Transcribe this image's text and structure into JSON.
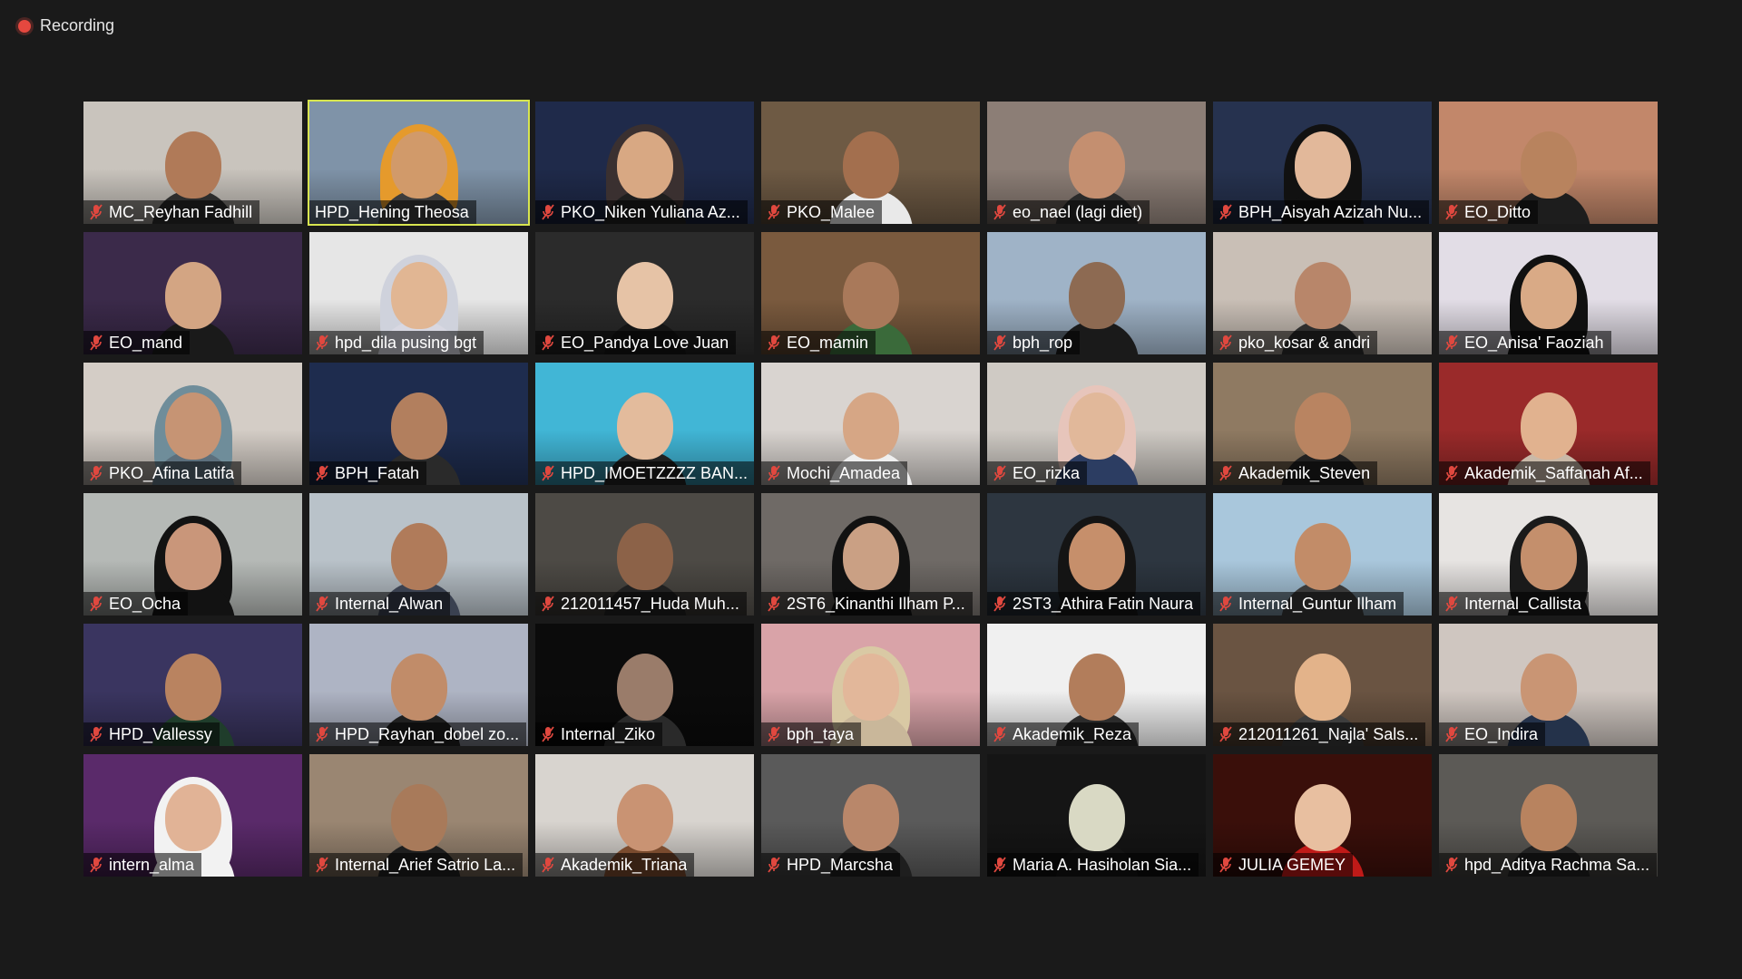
{
  "recording": {
    "label": "Recording",
    "dot_color": "#e5483f"
  },
  "active_speaker_border": "#d8e54f",
  "participants": [
    {
      "name": "MC_Reyhan Fadhill",
      "muted": true,
      "bg": "#c9c4bd",
      "skin": "#b07a58",
      "cloth": "#2c2c2c",
      "active": false
    },
    {
      "name": "HPD_Hening Theosa",
      "muted": false,
      "bg": "#7f93a8",
      "skin": "#d19a6a",
      "cloth": "#3c3c3c",
      "hijab": "#e59a2c",
      "active": true
    },
    {
      "name": "PKO_Niken Yuliana Az...",
      "muted": true,
      "bg": "#1f2a4a",
      "skin": "#d8a883",
      "cloth": "#1e1e1e",
      "hijab": "#3a3030",
      "active": false
    },
    {
      "name": "PKO_Malee",
      "muted": true,
      "bg": "#6e5a44",
      "skin": "#a36f4e",
      "cloth": "#e9e9e9",
      "active": false
    },
    {
      "name": "eo_nael (lagi diet)",
      "muted": true,
      "bg": "#8c7e76",
      "skin": "#c48f70",
      "cloth": "#2a2a2a",
      "active": false
    },
    {
      "name": "BPH_Aisyah Azizah Nu...",
      "muted": true,
      "bg": "#26324f",
      "skin": "#e2b89a",
      "cloth": "#111111",
      "hijab": "#111111",
      "active": false
    },
    {
      "name": "EO_Ditto",
      "muted": true,
      "bg": "#c2876a",
      "skin": "#b8835e",
      "cloth": "#1d1d1d",
      "active": false
    },
    {
      "name": "EO_mand",
      "muted": true,
      "bg": "#3b2a4a",
      "skin": "#d3a583",
      "cloth": "#1a1a1a",
      "active": false
    },
    {
      "name": "hpd_dila pusing bgt",
      "muted": true,
      "bg": "#e6e6e6",
      "skin": "#e1b693",
      "cloth": "#d8d8e2",
      "hijab": "#cfd2dc",
      "active": false
    },
    {
      "name": "EO_Pandya Love Juan",
      "muted": true,
      "bg": "#2b2b2b",
      "skin": "#e6c3a6",
      "cloth": "#151515",
      "active": false
    },
    {
      "name": "EO_mamin",
      "muted": true,
      "bg": "#7a5a3e",
      "skin": "#a9795a",
      "cloth": "#3a6a3a",
      "active": false
    },
    {
      "name": "bph_rop",
      "muted": true,
      "bg": "#9fb3c7",
      "skin": "#8d6a52",
      "cloth": "#1a1a1a",
      "active": false
    },
    {
      "name": "pko_kosar & andri",
      "muted": true,
      "bg": "#c9bfb6",
      "skin": "#b8866a",
      "cloth": "#2d2d2d",
      "active": false
    },
    {
      "name": "EO_Anisa' Faoziah",
      "muted": true,
      "bg": "#e2dde6",
      "skin": "#d9aa86",
      "cloth": "#101010",
      "hijab": "#101010",
      "active": false
    },
    {
      "name": "PKO_Afina Latifa",
      "muted": true,
      "bg": "#d4cdc6",
      "skin": "#c69474",
      "cloth": "#5c6f7c",
      "hijab": "#6f8d9a",
      "active": false
    },
    {
      "name": "BPH_Fatah",
      "muted": true,
      "bg": "#1e2c4e",
      "skin": "#b27f5e",
      "cloth": "#2a2a2a",
      "active": false
    },
    {
      "name": "HPD_IMOETZZZZ BAN...",
      "muted": true,
      "bg": "#41b6d6",
      "skin": "#e3bb9c",
      "cloth": "#202020",
      "active": false
    },
    {
      "name": "Mochi_Amadea",
      "muted": true,
      "bg": "#d9d4d0",
      "skin": "#d6a685",
      "cloth": "#efefef",
      "active": false
    },
    {
      "name": "EO_rizka",
      "muted": true,
      "bg": "#cfcac4",
      "skin": "#e1b89a",
      "cloth": "#2c3d62",
      "hijab": "#e7c5bb",
      "active": false
    },
    {
      "name": "Akademik_Steven",
      "muted": true,
      "bg": "#8f7a62",
      "skin": "#b98461",
      "cloth": "#202020",
      "active": false
    },
    {
      "name": "Akademik_Saffanah Af...",
      "muted": true,
      "bg": "#9a2a2a",
      "skin": "#e1b28f",
      "cloth": "#c9b9a8",
      "active": false
    },
    {
      "name": "EO_Ocha",
      "muted": true,
      "bg": "#b5b9b6",
      "skin": "#c9967a",
      "cloth": "#121212",
      "hijab": "#121212",
      "active": false
    },
    {
      "name": "Internal_Alwan",
      "muted": true,
      "bg": "#b9c2c9",
      "skin": "#b07b5a",
      "cloth": "#3a4150",
      "active": false
    },
    {
      "name": "212011457_Huda Muh...",
      "muted": true,
      "bg": "#4d4a45",
      "skin": "#8c6248",
      "cloth": "#202020",
      "active": false
    },
    {
      "name": "2ST6_Kinanthi Ilham P...",
      "muted": true,
      "bg": "#6f6a66",
      "skin": "#caa084",
      "cloth": "#111111",
      "hijab": "#111111",
      "active": false
    },
    {
      "name": "2ST3_Athira Fatin Naura",
      "muted": true,
      "bg": "#2d3640",
      "skin": "#c68f6b",
      "cloth": "#141414",
      "hijab": "#141414",
      "active": false
    },
    {
      "name": "Internal_Guntur Ilham",
      "muted": true,
      "bg": "#a9c7dc",
      "skin": "#c28c68",
      "cloth": "#3a3a3a",
      "active": false
    },
    {
      "name": "Internal_Callista",
      "muted": true,
      "bg": "#e7e4e2",
      "skin": "#c48f6c",
      "cloth": "#1a1a1a",
      "hijab": "#1a1a1a",
      "active": false
    },
    {
      "name": "HPD_Vallessy",
      "muted": true,
      "bg": "#3a3560",
      "skin": "#b98360",
      "cloth": "#1f3d2b",
      "active": false
    },
    {
      "name": "HPD_Rayhan_dobel zo...",
      "muted": true,
      "bg": "#aeb4c4",
      "skin": "#c18c69",
      "cloth": "#1f1f1f",
      "active": false
    },
    {
      "name": "Internal_Ziko",
      "muted": true,
      "bg": "#0b0b0b",
      "skin": "#9a7c6a",
      "cloth": "#2a2a2a",
      "active": false
    },
    {
      "name": "bph_taya",
      "muted": true,
      "bg": "#d9a3a8",
      "skin": "#e2b79a",
      "cloth": "#c9b79a",
      "hijab": "#d9c9a4",
      "active": false
    },
    {
      "name": "Akademik_Reza",
      "muted": true,
      "bg": "#f0f0f0",
      "skin": "#b27d5b",
      "cloth": "#2b2b2b",
      "active": false
    },
    {
      "name": "212011261_Najla' Sals...",
      "muted": true,
      "bg": "#6a5442",
      "skin": "#e3b38a",
      "cloth": "#3d3d3d",
      "active": false
    },
    {
      "name": "EO_Indira",
      "muted": true,
      "bg": "#cfc6c0",
      "skin": "#c99574",
      "cloth": "#24324a",
      "active": false
    },
    {
      "name": "intern_alma",
      "muted": true,
      "bg": "#5a2a6a",
      "skin": "#e1b396",
      "cloth": "#f2f2f2",
      "hijab": "#f2f2f2",
      "active": false
    },
    {
      "name": "Internal_Arief Satrio La...",
      "muted": true,
      "bg": "#9a8672",
      "skin": "#a87a5a",
      "cloth": "#1f1f1f",
      "active": false
    },
    {
      "name": "Akademik_Triana",
      "muted": true,
      "bg": "#d8d4cf",
      "skin": "#c99373",
      "cloth": "#7a4b2e",
      "active": false
    },
    {
      "name": "HPD_Marcsha",
      "muted": true,
      "bg": "#5a5a5a",
      "skin": "#b9876a",
      "cloth": "#1e1e1e",
      "active": false
    },
    {
      "name": "Maria A. Hasiholan Sia...",
      "muted": true,
      "bg": "#151515",
      "skin": "#d9d9c4",
      "cloth": "#151515",
      "active": false
    },
    {
      "name": "JULIA GEMEY",
      "muted": true,
      "bg": "#3a0f0a",
      "skin": "#e8bfa0",
      "cloth": "#c01a18",
      "active": false
    },
    {
      "name": "hpd_Aditya Rachma Sa...",
      "muted": true,
      "bg": "#5c5a56",
      "skin": "#b8835f",
      "cloth": "#232323",
      "active": false
    }
  ]
}
